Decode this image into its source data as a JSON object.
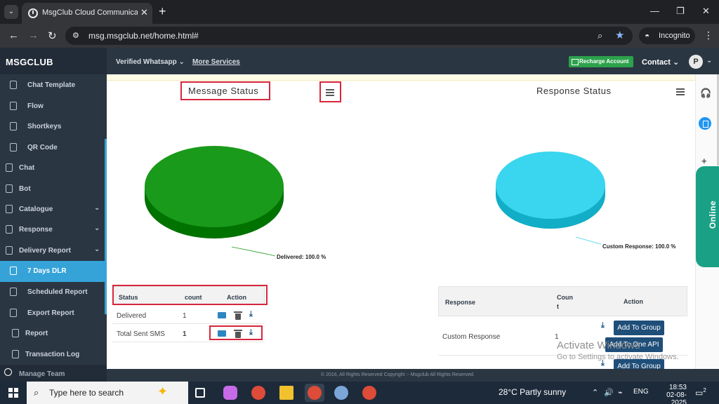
{
  "browser": {
    "tab_title": "MsgClub Cloud Communication",
    "url": "msg.msgclub.net/home.html#",
    "incognito_label": "Incognito"
  },
  "app": {
    "brand": "MSGCLUB",
    "header": {
      "nav_whatsapp": "Verified Whatsapp",
      "nav_more": "More Services",
      "recharge": "Recharge Account",
      "contact": "Contact",
      "avatar": "P"
    },
    "sidebar": {
      "items": [
        {
          "label": "Chat Template"
        },
        {
          "label": "Flow"
        },
        {
          "label": "Shortkeys"
        },
        {
          "label": "QR Code"
        },
        {
          "label": "Chat"
        },
        {
          "label": "Bot"
        },
        {
          "label": "Catalogue"
        },
        {
          "label": "Response"
        },
        {
          "label": "Delivery Report"
        },
        {
          "label": "7 Days DLR"
        },
        {
          "label": "Scheduled Report"
        },
        {
          "label": "Export Report"
        },
        {
          "label": "Report"
        },
        {
          "label": "Transaction Log"
        },
        {
          "label": "Manage Team"
        }
      ]
    },
    "message_status": {
      "title": "Message Status",
      "table_headers": [
        "Status",
        "count",
        "Action"
      ],
      "rows": [
        {
          "status": "Delivered",
          "count": "1"
        },
        {
          "status": "Total Sent SMS",
          "count": "1"
        }
      ]
    },
    "response_status": {
      "title": "Response Status",
      "table_headers": [
        "Response",
        "Coun\nt",
        "Action"
      ],
      "rows": [
        {
          "response": "Custom Response",
          "count": "1"
        }
      ],
      "buttons": {
        "add_to_group": "Add To Group",
        "add_to_one_api": "Add To One API",
        "add_to_group_2": "Add To Group"
      }
    },
    "online_label": "Online",
    "footer": "© 2016, All Rights Reserved Copyright :- Msgclub All Rights Reserved.",
    "watermark": {
      "line1": "Activate Windows",
      "line2": "Go to Settings to activate Windows."
    }
  },
  "chart_data": [
    {
      "type": "pie",
      "title": "Message Status",
      "slices": [
        {
          "label": "Delivered",
          "value": 100.0
        }
      ],
      "data_label": "Delivered: 100.0 %",
      "color": "#1a9a1a"
    },
    {
      "type": "pie",
      "title": "Response Status",
      "slices": [
        {
          "label": "Custom Response",
          "value": 100.0
        }
      ],
      "data_label": "Custom Response: 100.0 %",
      "color": "#3ad5ee"
    }
  ],
  "taskbar": {
    "search_placeholder": "Type here to search",
    "weather": "28°C  Partly sunny",
    "lang": "ENG",
    "time": "18:53",
    "date": "02-08-2025",
    "notifications": "2"
  },
  "colors": {
    "sidebar_bg": "#2b3643",
    "active_item": "#36a3d8",
    "highlight": "#d7263d",
    "recharge": "#2ca24c"
  }
}
